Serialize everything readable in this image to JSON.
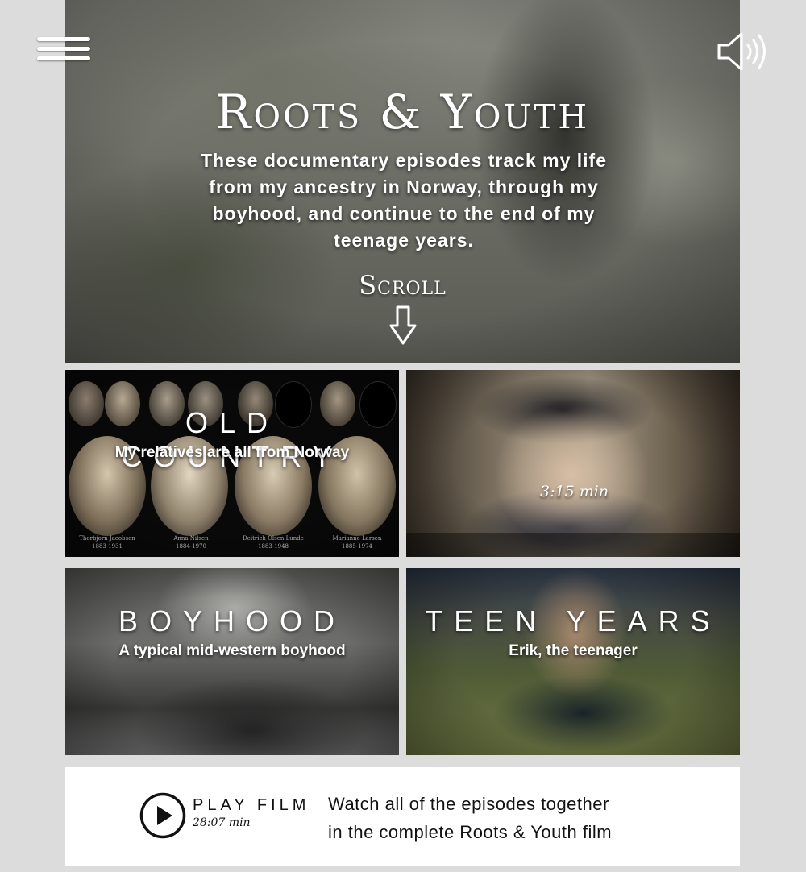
{
  "hero": {
    "title": "Roots & Youth",
    "description": "These documentary episodes track my life from my ancestry in Norway, through my boyhood, and continue to the end of my teenage years.",
    "scroll_label": "Scroll"
  },
  "episodes": [
    {
      "title": "OLD COUNTRY",
      "subtitle": "My relatives are all from Norway",
      "portraits": [
        {
          "name": "Thorbjorn Jacobsen",
          "years": "1883-1931"
        },
        {
          "name": "Anna Nilsen",
          "years": "1884-1970"
        },
        {
          "name": "Deitrich Olsen Lunde",
          "years": "1883-1948"
        },
        {
          "name": "Marianne Larsen",
          "years": "1885-1974"
        }
      ]
    },
    {
      "duration": "3:15 min"
    },
    {
      "title": "BOYHOOD",
      "subtitle": "A typical mid-western boyhood"
    },
    {
      "title": "TEEN YEARS",
      "subtitle": "Erik, the teenager"
    }
  ],
  "play_film": {
    "label": "PLAY FILM",
    "duration": "28:07 min",
    "description_line1": "Watch all of the episodes together",
    "description_line2": "in the complete Roots & Youth film"
  },
  "icons": {
    "menu": "hamburger-menu-icon",
    "sound": "speaker-icon",
    "scroll": "down-arrow-icon",
    "play": "play-icon"
  },
  "colors": {
    "page_background": "#dcdcdc",
    "overlay_text": "#ffffff",
    "play_panel": "#ffffff"
  }
}
